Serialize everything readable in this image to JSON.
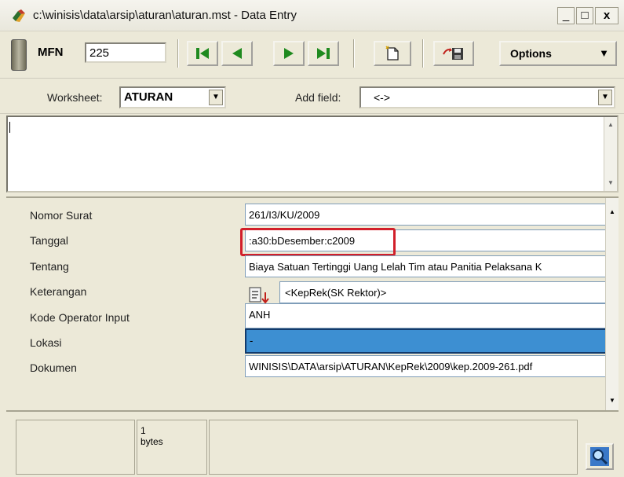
{
  "window": {
    "title": "c:\\winisis\\data\\arsip\\aturan\\aturan.mst - Data Entry",
    "minimize": "_",
    "maximize": "□",
    "close": "x"
  },
  "toolbar": {
    "mfn_label": "MFN",
    "mfn_value": "225",
    "options_label": "Options",
    "icons": [
      "database-icon",
      "first-record-icon",
      "previous-record-icon",
      "next-record-icon",
      "last-record-icon",
      "new-record-icon",
      "save-record-icon",
      "chevron-down-icon"
    ]
  },
  "worksheet_bar": {
    "worksheet_label": "Worksheet:",
    "worksheet_value": "ATURAN",
    "add_field_label": "Add field:",
    "add_field_value": "<->"
  },
  "fields": [
    {
      "label": "Nomor Surat",
      "value": "261/I3/KU/2009"
    },
    {
      "label": "Tanggal",
      "value": ":a30:bDesember:c2009"
    },
    {
      "label": "Tentang",
      "value": "Biaya Satuan Tertinggi Uang Lelah Tim atau Panitia Pelaksana K"
    },
    {
      "label": "Keterangan",
      "value": "<KepRek(SK Rektor)>"
    },
    {
      "label": "Kode Operator Input",
      "value": "ANH"
    },
    {
      "label": "Lokasi",
      "value": "-"
    },
    {
      "label": "Dokumen",
      "value": "WINISIS\\DATA\\arsip\\ATURAN\\KepRek\\2009\\kep.2009-261.pdf"
    }
  ],
  "status": {
    "bytes_count": "1",
    "bytes_label": "bytes"
  },
  "colors": {
    "highlight": "#d21f2a",
    "selected_field": "#3d8fd2",
    "nav_green": "#1f8a1f"
  }
}
